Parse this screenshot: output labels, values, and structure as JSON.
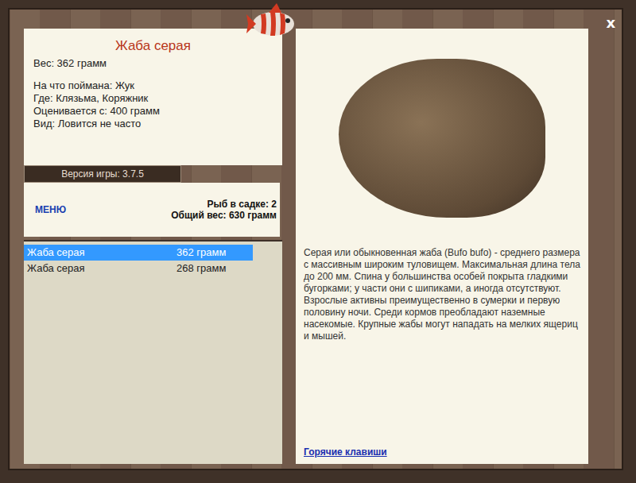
{
  "window": {
    "close": "x"
  },
  "fish_card": {
    "title": "Жаба серая",
    "weight": "Вес: 362 грамм",
    "details": [
      "На что поймана: Жук",
      "Где: Клязьма, Коряжник",
      "Оценивается с: 400 грамм",
      "Вид: Ловится не часто"
    ]
  },
  "version": "Версия игры: 3.7.5",
  "menu_link": "МЕНЮ",
  "keepnet": {
    "count": "Рыб в садке: 2",
    "total": "Общий вес: 630 грамм"
  },
  "catch_list": [
    {
      "name": "Жаба серая",
      "weight": "362 грамм",
      "selected": true
    },
    {
      "name": "Жаба серая",
      "weight": "268 грамм",
      "selected": false
    }
  ],
  "description": "Серая или обыкновенная жаба (Bufo bufo) - среднего размера с массивным широким туловищем. Максимальная длина тела до 200 мм. Спина у большинства особей покрыта гладкими бугорками; у части они с шипиками, а иногда отсутствуют. Взрослые активны преимущественно в сумерки и первую половину ночи. Среди кормов преобладают наземные насекомые. Крупные жабы могут нападать на мелких ящериц и мышей.",
  "hotkeys_link": "Горячие клавиши"
}
